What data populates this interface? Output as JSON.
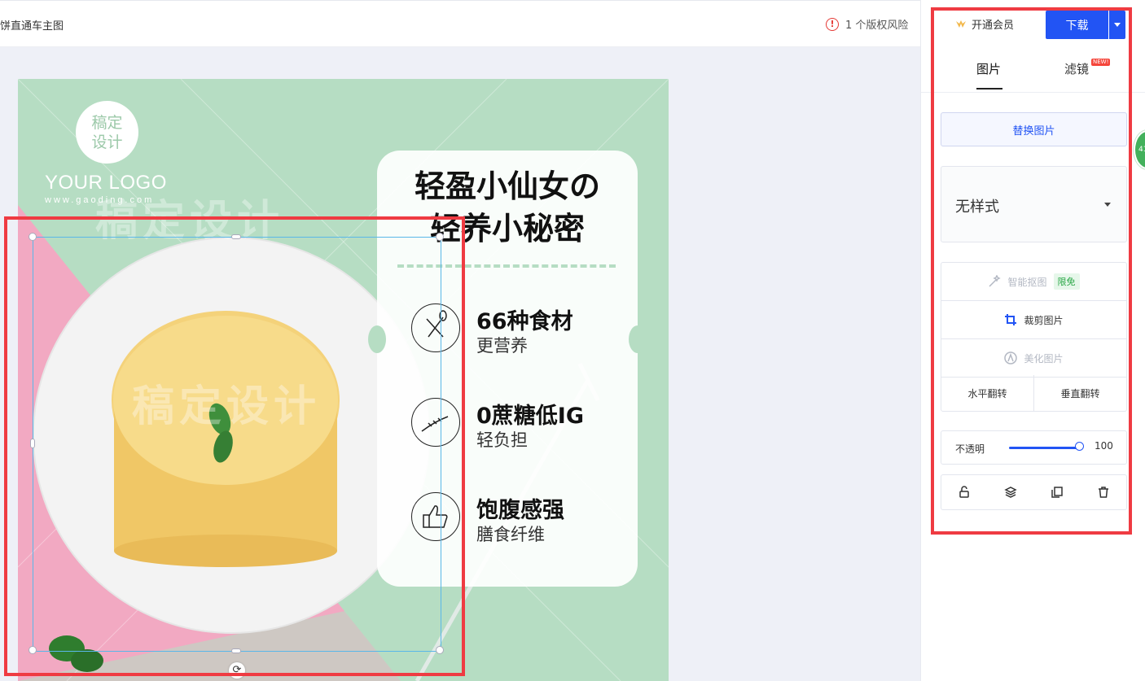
{
  "header": {
    "doc_title": "饼直通车主图",
    "risk_text": "1 个版权风险"
  },
  "toolbar": {
    "vip_label": "开通会员",
    "download_label": "下载"
  },
  "panel": {
    "tabs": [
      {
        "label": "图片"
      },
      {
        "label": "滤镜"
      }
    ],
    "new_badge": "NEW!",
    "replace_label": "替换图片",
    "style_value": "无样式",
    "smart_cutout_label": "智能抠图",
    "free_badge": "限免",
    "crop_label": "裁剪图片",
    "beautify_label": "美化图片",
    "flip_h_label": "水平翻转",
    "flip_v_label": "垂直翻转",
    "opacity_label": "不透明",
    "opacity_value": "100",
    "side_pill": "41"
  },
  "canvas": {
    "logo_line1": "稿定",
    "logo_line2": "设计",
    "your_logo": "YOUR LOGO",
    "logo_url": "www.gaoding.com",
    "watermark": "稿定设计",
    "card_title_1": "轻盈小仙女の",
    "card_title_2": "轻养小秘密",
    "features": [
      {
        "title": "66种食材",
        "sub": "更营养"
      },
      {
        "title": "0蔗糖低IG",
        "sub": "轻负担"
      },
      {
        "title": "饱腹感强",
        "sub": "膳食纤维"
      }
    ]
  },
  "colors": {
    "accent": "#2254f4",
    "highlight": "#ef3b42",
    "canvas_green": "#b6ddc3",
    "canvas_pink": "#f0a7c0"
  }
}
